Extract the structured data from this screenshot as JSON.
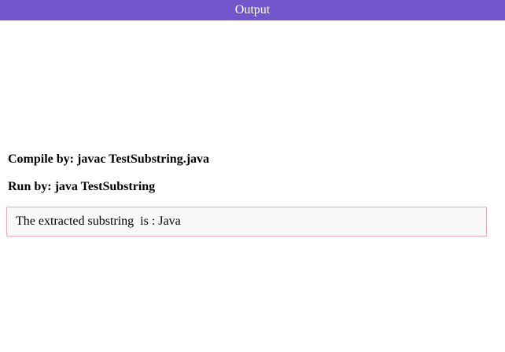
{
  "header": {
    "title": "Output",
    "background_color": "#7256cc",
    "text_color": "#ffffff"
  },
  "instructions": {
    "compile": "Compile by: javac TestSubstring.java",
    "run": "Run by: java TestSubstring"
  },
  "output": {
    "text": "The extracted substring  is : Java",
    "border_color": "#f0a8b8",
    "background_color": "#f9f9f9"
  }
}
